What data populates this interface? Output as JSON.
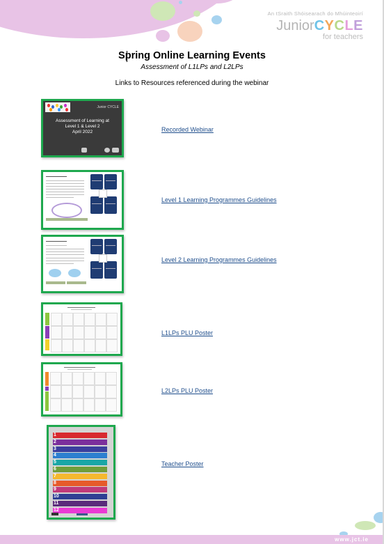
{
  "header": {
    "logo": {
      "irish_line": "An tSraith Shóisearach do Mhúinteoirí",
      "junior": "Junior",
      "cycle_letters": [
        {
          "ch": "C",
          "color": "#6fc3e8"
        },
        {
          "ch": "Y",
          "color": "#f3a85a"
        },
        {
          "ch": "C",
          "color": "#b9d98a"
        },
        {
          "ch": "L",
          "color": "#e59fdc"
        },
        {
          "ch": "E",
          "color": "#c1a0db"
        }
      ],
      "tagline": "for teachers"
    }
  },
  "document": {
    "title": "Spring Online Learning Events",
    "subtitle": "Assessment of L1LPs and L2LPs",
    "intro": "Links to Resources referenced during the webinar"
  },
  "resources": [
    {
      "link_label": "Recorded Webinar",
      "thumb_text": [
        "Assessment of Learning at",
        "Level 1 & Level 2",
        "April 2022"
      ],
      "thumb_logo": "Junior CYCLE"
    },
    {
      "link_label": "Level 1 Learning Programmes Guidelines"
    },
    {
      "link_label": "Level 2 Learning Programmes Guidelines"
    },
    {
      "link_label": "L1LPs PLU Poster"
    },
    {
      "link_label": "L2LPs PLU Poster"
    },
    {
      "link_label": "Teacher Poster",
      "poster_numbers": [
        "1",
        "2",
        "3",
        "4",
        "5",
        "6",
        "7",
        "8",
        "9",
        "10",
        "11",
        "12"
      ]
    }
  ],
  "footer": {
    "url": "www.jct.ie"
  },
  "colors": {
    "accent_pink": "#e8c3e6",
    "thumb_border": "#1ea84e",
    "link": "#1f4e8c",
    "poster_bands": [
      "#d8292f",
      "#7b2f9c",
      "#3b3f9e",
      "#2d7fd0",
      "#1aa6a6",
      "#6f9e3a",
      "#f5b82e",
      "#e65a2a",
      "#c03a7a",
      "#2e3f94",
      "#5a2a7a",
      "#e93ad4"
    ]
  }
}
